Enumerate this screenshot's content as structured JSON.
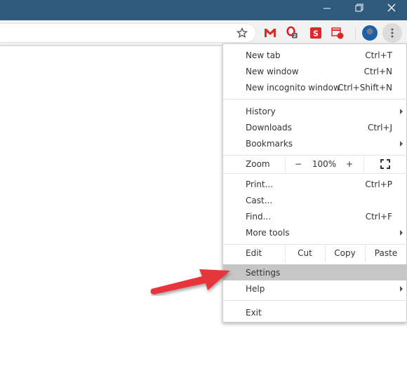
{
  "window_controls": {
    "minimize_icon": "minimize-icon",
    "restore_icon": "restore-icon",
    "close_icon": "close-icon"
  },
  "toolbar": {
    "bookmark_icon": "star-icon",
    "extensions": [
      {
        "name": "gmail",
        "icon": "gmail-icon",
        "color": "#d93025"
      },
      {
        "name": "opera",
        "icon": "opera-icon",
        "color": "#e8141c",
        "badge": "2"
      },
      {
        "name": "s-extension",
        "icon": "s-icon",
        "color": "#e0262a"
      },
      {
        "name": "calendar",
        "icon": "calendar-icon",
        "color": "#e0262a"
      }
    ],
    "avatar_icon": "profile-avatar",
    "menu_icon": "kebab-menu-icon"
  },
  "menu": {
    "items_top": [
      {
        "label": "New tab",
        "shortcut": "Ctrl+T"
      },
      {
        "label": "New window",
        "shortcut": "Ctrl+N"
      },
      {
        "label": "New incognito window",
        "shortcut": "Ctrl+Shift+N"
      }
    ],
    "items_nav": [
      {
        "label": "History",
        "submenu": true
      },
      {
        "label": "Downloads",
        "shortcut": "Ctrl+J"
      },
      {
        "label": "Bookmarks",
        "submenu": true
      }
    ],
    "zoom": {
      "label": "Zoom",
      "minus": "−",
      "value": "100%",
      "plus": "+",
      "fullscreen_icon": "fullscreen-icon"
    },
    "items_tools": [
      {
        "label": "Print...",
        "shortcut": "Ctrl+P"
      },
      {
        "label": "Cast..."
      },
      {
        "label": "Find...",
        "shortcut": "Ctrl+F"
      },
      {
        "label": "More tools",
        "submenu": true
      }
    ],
    "edit": {
      "label": "Edit",
      "cut": "Cut",
      "copy": "Copy",
      "paste": "Paste"
    },
    "items_settings": [
      {
        "label": "Settings",
        "highlighted": true
      },
      {
        "label": "Help",
        "submenu": true
      }
    ],
    "exit": {
      "label": "Exit"
    }
  },
  "annotation": {
    "arrow_color": "#e8353a",
    "points_to": "Settings"
  },
  "colors": {
    "titlebar": "#2f5a7c",
    "highlight": "#c6c6c6"
  }
}
